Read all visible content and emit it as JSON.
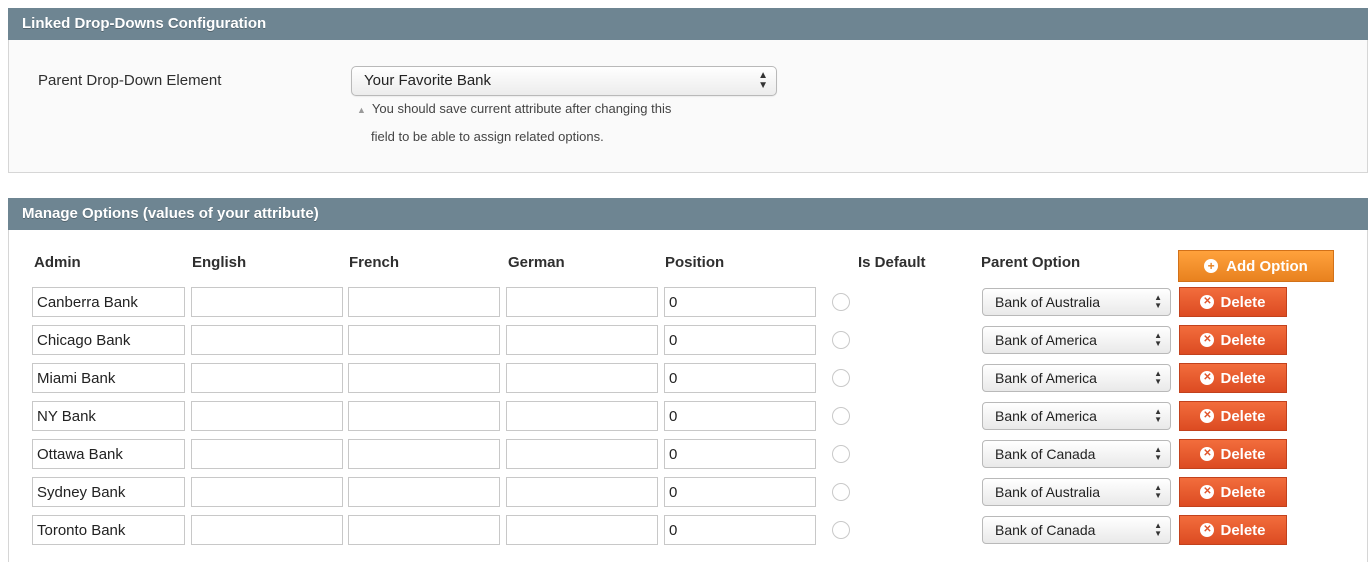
{
  "config": {
    "title": "Linked Drop-Downs Configuration",
    "parent_label": "Parent Drop-Down Element",
    "parent_value": "Your Favorite Bank",
    "hint_line1": "You should save current attribute after changing this",
    "hint_line2": "field to be able to assign related options."
  },
  "options": {
    "title": "Manage Options (values of your attribute)",
    "columns": {
      "admin": "Admin",
      "english": "English",
      "french": "French",
      "german": "German",
      "position": "Position",
      "is_default": "Is Default",
      "parent_option": "Parent Option"
    },
    "add_label": "Add Option",
    "delete_label": "Delete",
    "rows": [
      {
        "admin": "Canberra Bank",
        "english": "",
        "french": "",
        "german": "",
        "position": "0",
        "parent": "Bank of Australia"
      },
      {
        "admin": "Chicago Bank",
        "english": "",
        "french": "",
        "german": "",
        "position": "0",
        "parent": "Bank of America"
      },
      {
        "admin": "Miami Bank",
        "english": "",
        "french": "",
        "german": "",
        "position": "0",
        "parent": "Bank of America"
      },
      {
        "admin": "NY Bank",
        "english": "",
        "french": "",
        "german": "",
        "position": "0",
        "parent": "Bank of America"
      },
      {
        "admin": "Ottawa Bank",
        "english": "",
        "french": "",
        "german": "",
        "position": "0",
        "parent": "Bank of Canada"
      },
      {
        "admin": "Sydney Bank",
        "english": "",
        "french": "",
        "german": "",
        "position": "0",
        "parent": "Bank of Australia"
      },
      {
        "admin": "Toronto Bank",
        "english": "",
        "french": "",
        "german": "",
        "position": "0",
        "parent": "Bank of Canada"
      }
    ]
  },
  "icons": {
    "select_arrows": "updown-arrows-icon",
    "hint": "warning-triangle-icon",
    "add": "plus-circle-icon",
    "delete": "x-circle-icon"
  },
  "colors": {
    "header_bg": "#6e8592",
    "add_button": "#f0952d",
    "delete_button": "#e4552b"
  }
}
